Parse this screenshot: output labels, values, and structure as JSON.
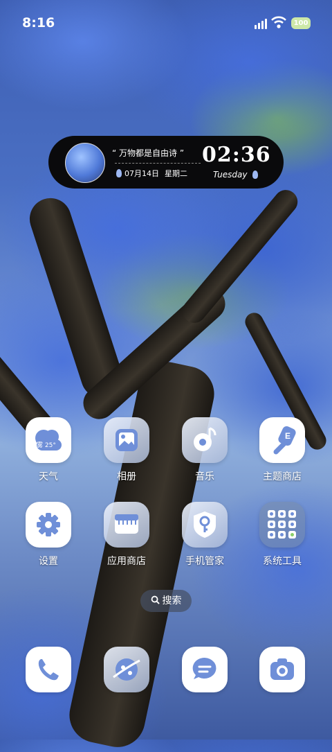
{
  "status": {
    "time": "8:16",
    "battery": "100"
  },
  "widget": {
    "quote": "“ 万物都是自由诗 ”",
    "date": "07月14日",
    "weekday_cn": "星期二",
    "clock": "02:36",
    "weekday_en": "Tuesday"
  },
  "weather": {
    "condition": "雾",
    "temp": "25°"
  },
  "apps": [
    {
      "label": "天气",
      "icon": "weather-icon"
    },
    {
      "label": "相册",
      "icon": "gallery-icon"
    },
    {
      "label": "音乐",
      "icon": "music-icon"
    },
    {
      "label": "主题商店",
      "icon": "theme-store-icon"
    },
    {
      "label": "设置",
      "icon": "settings-gear-icon"
    },
    {
      "label": "应用商店",
      "icon": "app-store-icon"
    },
    {
      "label": "手机管家",
      "icon": "phone-manager-icon"
    },
    {
      "label": "系统工具",
      "icon": "system-tools-folder-icon"
    }
  ],
  "search": {
    "label": "搜索"
  },
  "dock": [
    {
      "icon": "phone-icon"
    },
    {
      "icon": "browser-icon"
    },
    {
      "icon": "messages-icon"
    },
    {
      "icon": "camera-icon"
    }
  ],
  "colors": {
    "icon_blue": "#6f8fd8",
    "widget_bg": "#0a0a0c"
  }
}
